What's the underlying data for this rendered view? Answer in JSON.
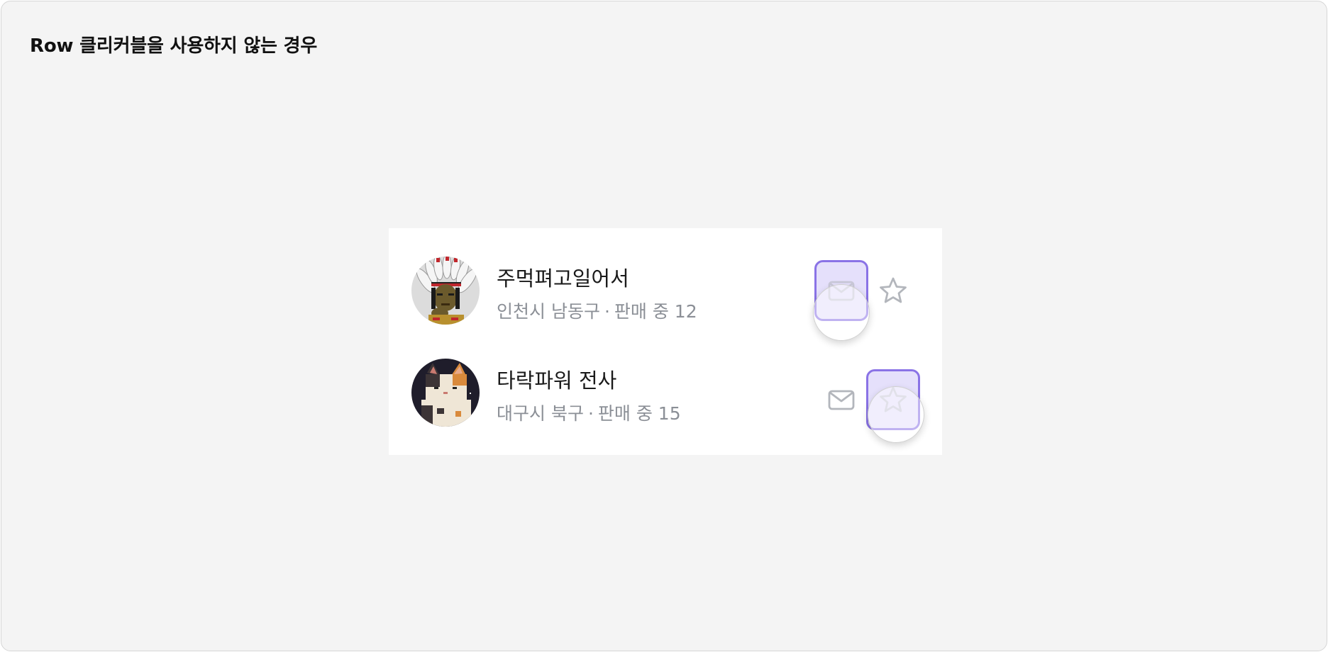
{
  "frame": {
    "title": "Row 클리커블을 사용하지 않는 경우"
  },
  "rows": [
    {
      "name": "주먹펴고일어서",
      "location": "인천시 남동구",
      "separator": "·",
      "sales": "판매 중 12",
      "pressed_button": "mail"
    },
    {
      "name": "타락파워 전사",
      "location": "대구시 북구",
      "separator": "·",
      "sales": "판매 중 15",
      "pressed_button": "star"
    }
  ],
  "icons": {
    "message": "mail-icon",
    "favorite": "star-icon"
  },
  "colors": {
    "background": "#f4f4f4",
    "card": "#ffffff",
    "pressed_fill": "#e5e0fb",
    "pressed_border": "#8a73e6",
    "meta_text": "#8b8f96",
    "icon": "#b3b6bc"
  }
}
